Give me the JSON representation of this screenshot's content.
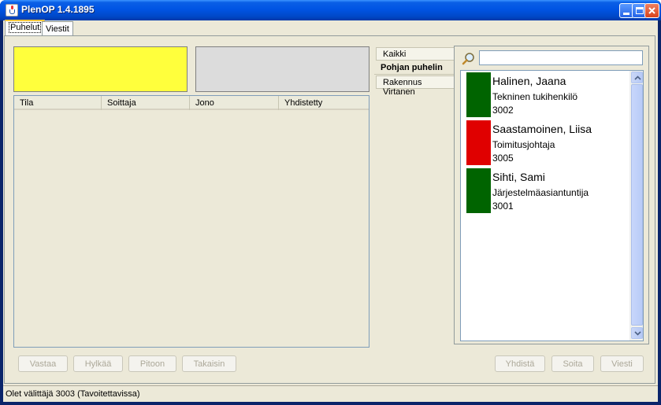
{
  "window": {
    "title": "PlenOP 1.4.1895"
  },
  "tabs": [
    {
      "label": "Puhelut"
    },
    {
      "label": "Viestit"
    }
  ],
  "calls_table": {
    "columns": [
      "Tila",
      "Soittaja",
      "Jono",
      "Yhdistetty"
    ],
    "rows": []
  },
  "call_buttons": {
    "answer": "Vastaa",
    "reject": "Hylkää",
    "hold": "Pitoon",
    "back": "Takaisin"
  },
  "side_tabs": [
    {
      "label": "Kaikki"
    },
    {
      "label": "Pohjan puhelin"
    },
    {
      "label": "Rakennus Virtanen"
    }
  ],
  "search": {
    "value": "",
    "placeholder": ""
  },
  "contacts": [
    {
      "name": "Halinen, Jaana",
      "role": "Tekninen tukihenkilö",
      "ext": "3002",
      "status_color": "#006400"
    },
    {
      "name": "Saastamoinen, Liisa",
      "role": "Toimitusjohtaja",
      "ext": "3005",
      "status_color": "#e00000"
    },
    {
      "name": "Sihti, Sami",
      "role": "Järjestelmäasiantuntija",
      "ext": "3001",
      "status_color": "#006400"
    }
  ],
  "contact_buttons": {
    "connect": "Yhdistä",
    "call": "Soita",
    "message": "Viesti"
  },
  "status": {
    "text": "Olet välittäjä 3003 (Tavoitettavissa)"
  },
  "colors": {
    "active_call_panel": "#ffff3c",
    "idle_panel": "#dcdcdc",
    "available": "#006400",
    "busy": "#e00000"
  }
}
